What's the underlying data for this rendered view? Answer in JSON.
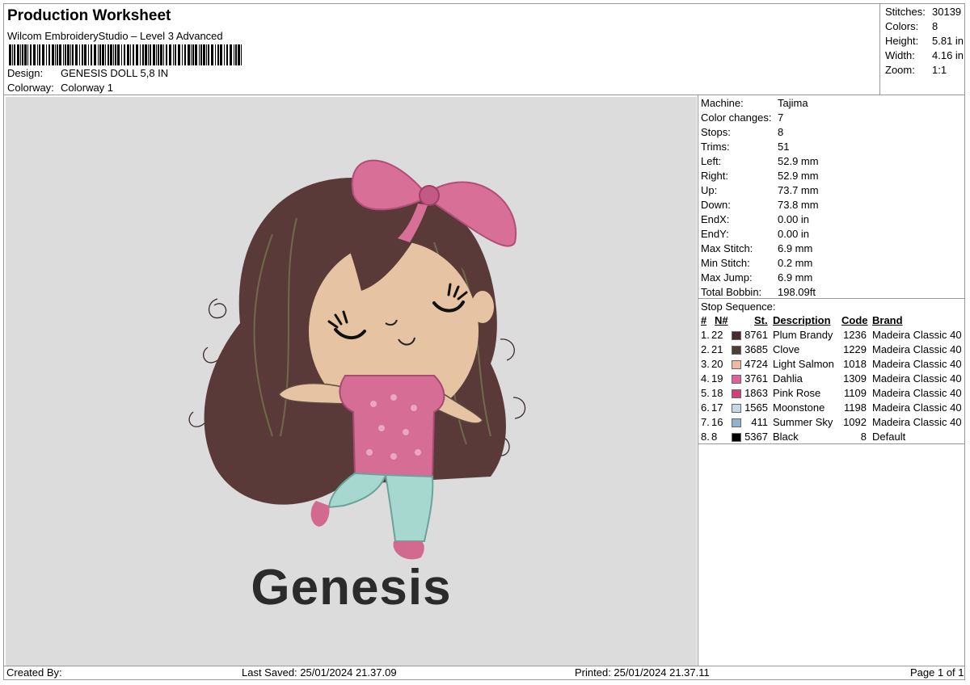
{
  "header": {
    "title": "Production Worksheet",
    "software": "Wilcom EmbroideryStudio – Level 3 Advanced",
    "design_label": "Design:",
    "design_value": "GENESIS DOLL 5,8 IN",
    "colorway_label": "Colorway:",
    "colorway_value": "Colorway 1"
  },
  "stats": [
    {
      "label": "Stitches:",
      "value": "30139"
    },
    {
      "label": "Colors:",
      "value": "8"
    },
    {
      "label": "Height:",
      "value": "5.81 in"
    },
    {
      "label": "Width:",
      "value": "4.16 in"
    },
    {
      "label": "Zoom:",
      "value": "1:1"
    }
  ],
  "preview": {
    "name_text": "Genesis"
  },
  "machine_info": [
    {
      "label": "Machine:",
      "value": "Tajima"
    },
    {
      "label": "Color changes:",
      "value": "7"
    },
    {
      "label": "Stops:",
      "value": "8"
    },
    {
      "label": "Trims:",
      "value": "51"
    },
    {
      "label": "Left:",
      "value": "52.9 mm"
    },
    {
      "label": "Right:",
      "value": "52.9 mm"
    },
    {
      "label": "Up:",
      "value": "73.7 mm"
    },
    {
      "label": "Down:",
      "value": "73.8 mm"
    },
    {
      "label": "EndX:",
      "value": "0.00 in"
    },
    {
      "label": "EndY:",
      "value": "0.00 in"
    },
    {
      "label": "Max Stitch:",
      "value": "6.9 mm"
    },
    {
      "label": "Min Stitch:",
      "value": "0.2 mm"
    },
    {
      "label": "Max Jump:",
      "value": "6.9 mm"
    },
    {
      "label": "Total Bobbin:",
      "value": "198.09ft"
    }
  ],
  "stop_sequence": {
    "title": "Stop Sequence:",
    "headers": {
      "num": "#",
      "n": "N#",
      "st": "St.",
      "desc": "Description",
      "code": "Code",
      "brand": "Brand"
    },
    "rows": [
      {
        "num": "1.",
        "n": "22",
        "color": "#4a2a2e",
        "st": "8761",
        "desc": "Plum Brandy",
        "code": "1236",
        "brand": "Madeira Classic 40"
      },
      {
        "num": "2.",
        "n": "21",
        "color": "#4d3d33",
        "st": "3685",
        "desc": "Clove",
        "code": "1229",
        "brand": "Madeira Classic 40"
      },
      {
        "num": "3.",
        "n": "20",
        "color": "#f0b8a0",
        "st": "4724",
        "desc": "Light Salmon",
        "code": "1018",
        "brand": "Madeira Classic 40"
      },
      {
        "num": "4.",
        "n": "19",
        "color": "#e0609a",
        "st": "3761",
        "desc": "Dahlia",
        "code": "1309",
        "brand": "Madeira Classic 40"
      },
      {
        "num": "5.",
        "n": "18",
        "color": "#d0407a",
        "st": "1863",
        "desc": "Pink Rose",
        "code": "1109",
        "brand": "Madeira Classic 40"
      },
      {
        "num": "6.",
        "n": "17",
        "color": "#c4d8ea",
        "st": "1565",
        "desc": "Moonstone",
        "code": "1198",
        "brand": "Madeira Classic 40"
      },
      {
        "num": "7.",
        "n": "16",
        "color": "#90b4d0",
        "st": "411",
        "desc": "Summer Sky",
        "code": "1092",
        "brand": "Madeira Classic 40"
      },
      {
        "num": "8.",
        "n": "8",
        "color": "#000000",
        "st": "5367",
        "desc": "Black",
        "code": "8",
        "brand": "Default"
      }
    ]
  },
  "footer": {
    "created_by": "Created By:",
    "last_saved": "Last Saved: 25/01/2024 21.37.09",
    "printed": "Printed: 25/01/2024 21.37.11",
    "page": "Page 1 of 1"
  }
}
